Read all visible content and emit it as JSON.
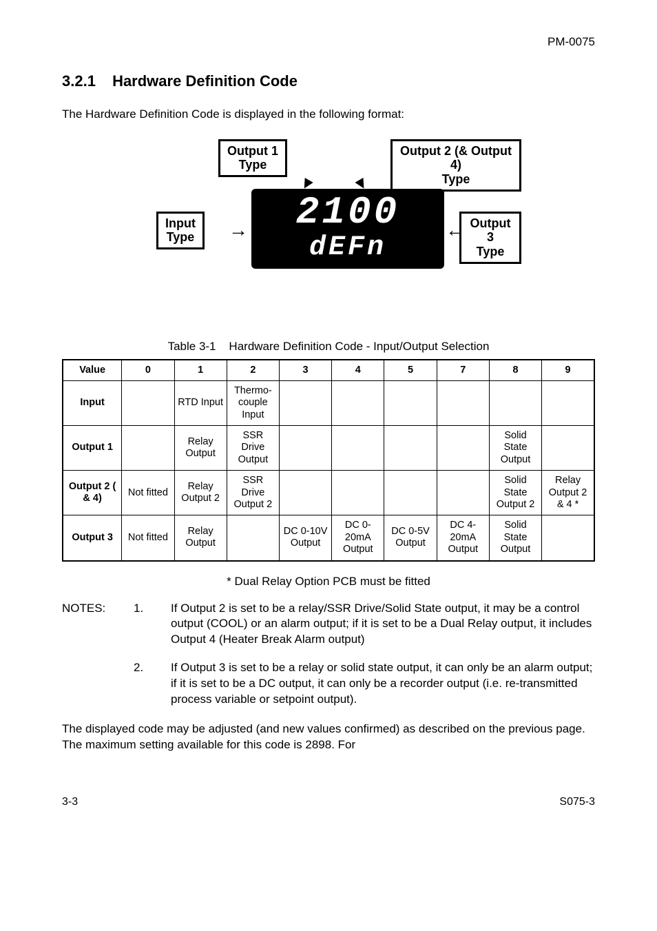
{
  "doc_code": "PM-0075",
  "section_number": "3.2.1",
  "section_title": "Hardware Definition Code",
  "intro": "The Hardware Definition Code is displayed in the following format:",
  "diagram": {
    "output1_label_l1": "Output 1",
    "output1_label_l2": "Type",
    "output24_label_l1": "Output 2 (& Output 4)",
    "output24_label_l2": "Type",
    "input_label_l1": "Input",
    "input_label_l2": "Type",
    "output3_label_l1": "Output 3",
    "output3_label_l2": "Type",
    "display_top": "2100",
    "display_bottom": "dEFn"
  },
  "table_caption_prefix": "Table 3-1",
  "table_caption_text": "Hardware Definition Code - Input/Output Selection",
  "table": {
    "head": [
      "Value",
      "0",
      "1",
      "2",
      "3",
      "4",
      "5",
      "7",
      "8",
      "9"
    ],
    "rows": [
      {
        "label": "Input",
        "cells": [
          "",
          "RTD Input",
          "Thermo-couple Input",
          "",
          "",
          "",
          "",
          "",
          ""
        ]
      },
      {
        "label": "Output 1",
        "cells": [
          "",
          "Relay Output",
          "SSR Drive Output",
          "",
          "",
          "",
          "",
          "Solid State Output",
          ""
        ]
      },
      {
        "label": "Output 2 ( & 4)",
        "cells": [
          "Not fitted",
          "Relay Output 2",
          "SSR Drive Output 2",
          "",
          "",
          "",
          "",
          "Solid State Output 2",
          "Relay Output 2 & 4 *"
        ]
      },
      {
        "label": "Output 3",
        "cells": [
          "Not fitted",
          "Relay Output",
          "",
          "DC 0-10V Output",
          "DC 0-20mA Output",
          "DC 0-5V Output",
          "DC 4-20mA Output",
          "Solid State Output",
          ""
        ]
      }
    ]
  },
  "footnote": "* Dual Relay Option PCB must be fitted",
  "notes_label": "NOTES:",
  "notes": [
    {
      "num": "1.",
      "text": "If Output 2 is set to be a relay/SSR Drive/Solid State output, it may be a control output (COOL) or an alarm output; if it is set to be a Dual Relay output, it includes Output 4 (Heater Break Alarm output)"
    },
    {
      "num": "2.",
      "text": "If Output 3 is set to be a relay or solid state output, it can only be an alarm output; if it is set to be a DC output, it can only be a recorder output (i.e. re-transmitted process variable or setpoint output)."
    }
  ],
  "closing_para": "The displayed code may be adjusted (and new values confirmed) as described on the previous page. The maximum setting available for this code is 2898. For",
  "footer_left": "3-3",
  "footer_right": "S075-3"
}
